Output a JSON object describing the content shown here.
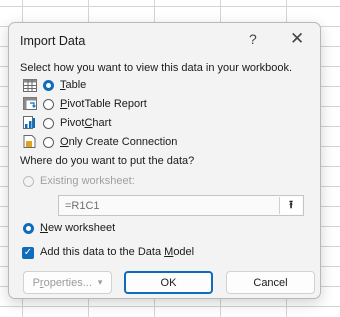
{
  "dialog": {
    "title": "Import Data",
    "help_glyph": "?",
    "close_glyph": "✕"
  },
  "view_section": {
    "heading": "Select how you want to view this data in your workbook.",
    "options": [
      {
        "label_pre": "",
        "label_ul": "T",
        "label_post": "able",
        "icon": "table-icon",
        "selected": true
      },
      {
        "label_pre": "",
        "label_ul": "P",
        "label_post": "ivotTable Report",
        "icon": "pivottable-icon",
        "selected": false
      },
      {
        "label_pre": "Pivot",
        "label_ul": "C",
        "label_post": "hart",
        "icon": "pivotchart-icon",
        "selected": false
      },
      {
        "label_pre": "",
        "label_ul": "O",
        "label_post": "nly Create Connection",
        "icon": "connection-icon",
        "selected": false
      }
    ]
  },
  "location_section": {
    "heading": "Where do you want to put the data?",
    "existing_label": "Existing worksheet:",
    "existing_value": "=R1C1",
    "collapse_glyph": "⭱",
    "new_label_ul": "N",
    "new_label_post": "ew worksheet"
  },
  "data_model": {
    "label_pre": "Add this data to the Data ",
    "label_ul": "M",
    "label_post": "odel",
    "checked": true,
    "check_glyph": "✓"
  },
  "buttons": {
    "properties_pre": "P",
    "properties_ul": "r",
    "properties_post": "operties...",
    "properties_caret": "▾",
    "ok": "OK",
    "cancel": "Cancel"
  },
  "colors": {
    "accent": "#0f6cbd",
    "dialog_bg": "#f3f3f3"
  }
}
